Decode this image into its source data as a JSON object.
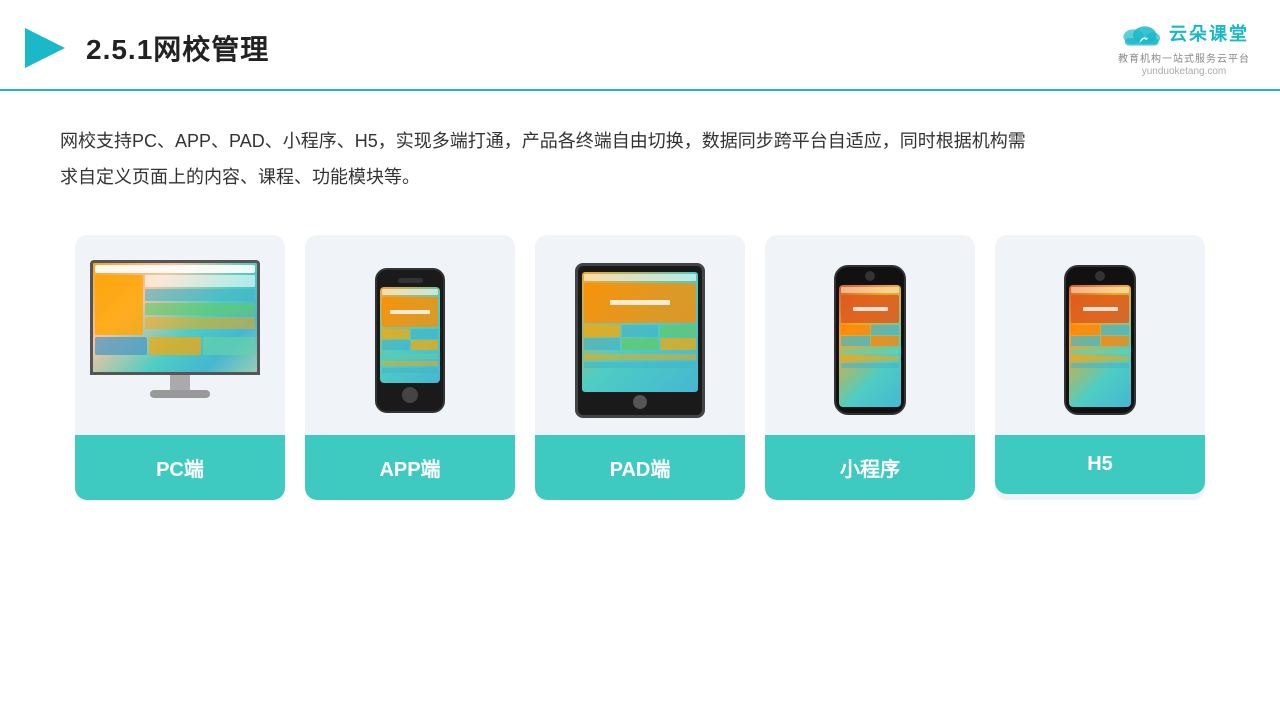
{
  "header": {
    "title": "2.5.1网校管理",
    "logo_name": "云朵课堂",
    "logo_url": "yunduoketang.com",
    "logo_tagline": "教育机构一站式服务云平台"
  },
  "description": {
    "text": "网校支持PC、APP、PAD、小程序、H5，实现多端打通，产品各终端自由切换，数据同步跨平台自适应，同时根据机构需求自定义页面上的内容、课程、功能模块等。"
  },
  "cards": [
    {
      "id": "pc",
      "label": "PC端"
    },
    {
      "id": "app",
      "label": "APP端"
    },
    {
      "id": "pad",
      "label": "PAD端"
    },
    {
      "id": "miniapp",
      "label": "小程序"
    },
    {
      "id": "h5",
      "label": "H5"
    }
  ],
  "colors": {
    "accent": "#3ecac0",
    "header_border": "#1ab8c8",
    "card_bg": "#edf2f7"
  }
}
